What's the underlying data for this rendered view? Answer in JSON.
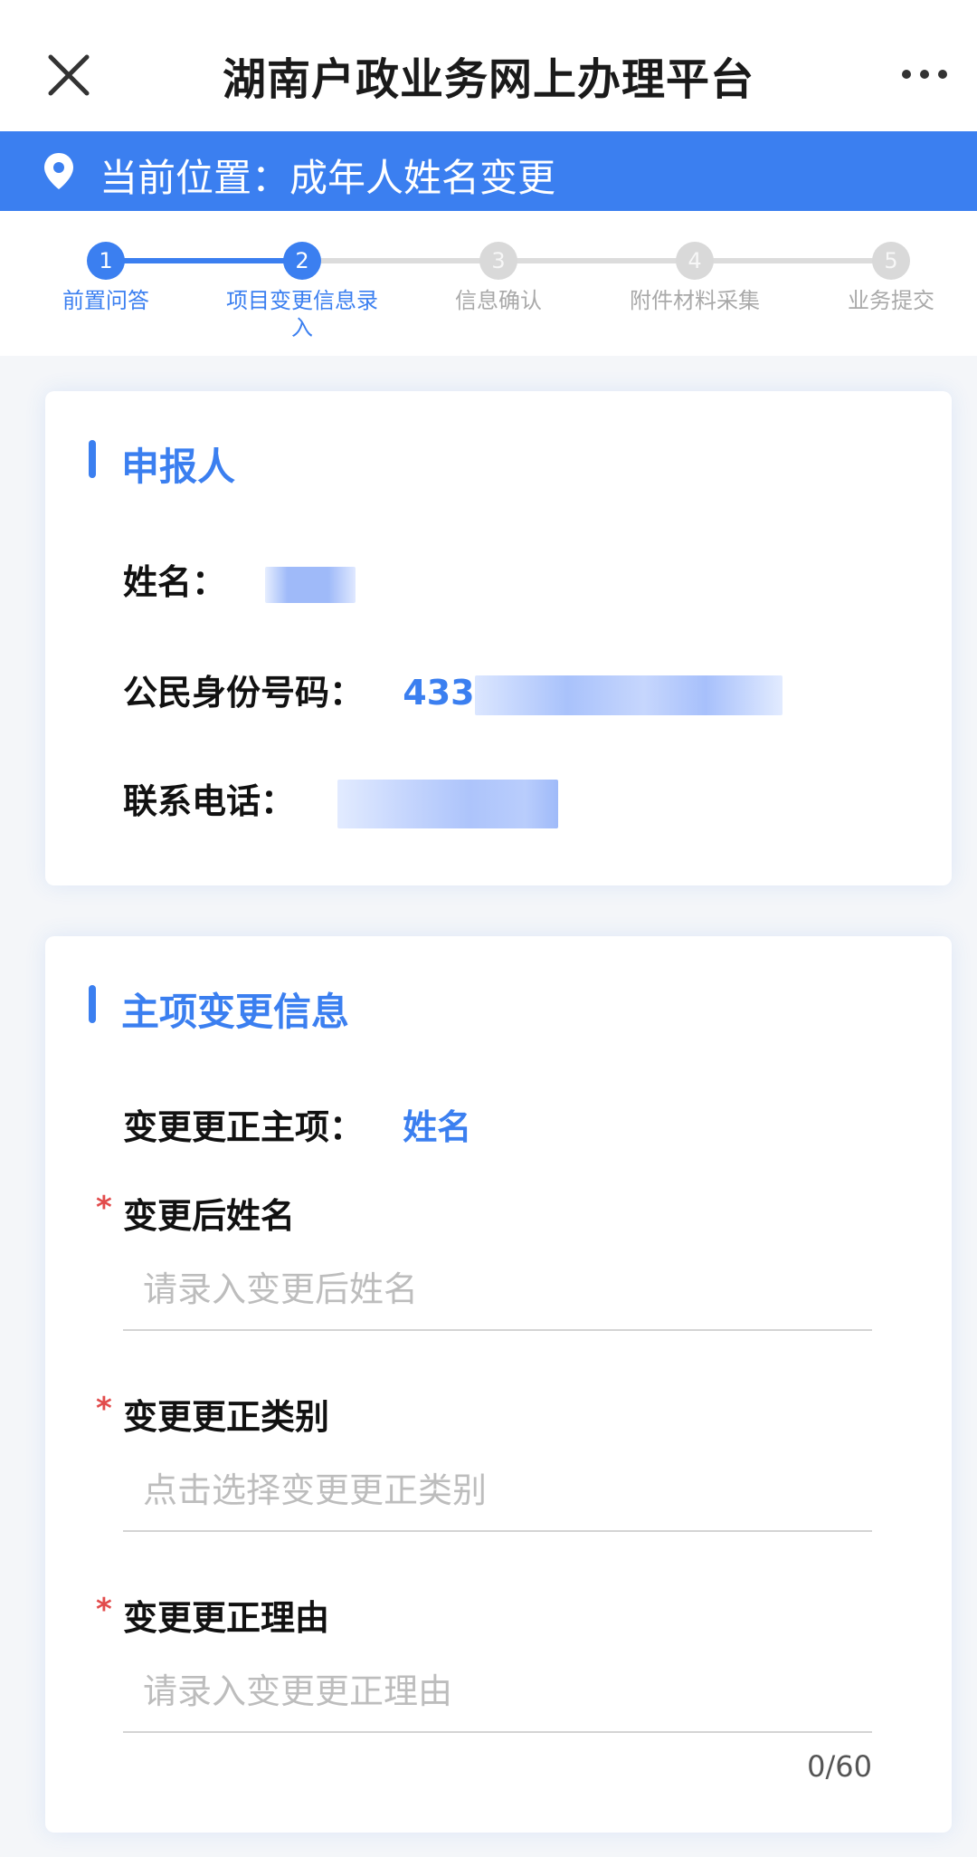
{
  "header": {
    "title": "湖南户政业务网上办理平台",
    "close_icon": "close-icon",
    "more_icon": "more-dots-icon"
  },
  "location": {
    "icon": "location-pin-icon",
    "label": "当前位置：成年人姓名变更"
  },
  "steps": [
    {
      "num": "1",
      "label": "前置问答",
      "state": "done"
    },
    {
      "num": "2",
      "label": "项目变更信息录入",
      "state": "current"
    },
    {
      "num": "3",
      "label": "信息确认",
      "state": "todo"
    },
    {
      "num": "4",
      "label": "附件材料采集",
      "state": "todo"
    },
    {
      "num": "5",
      "label": "业务提交",
      "state": "todo"
    }
  ],
  "applicant": {
    "section_title": "申报人",
    "name_label": "姓名：",
    "id_label": "公民身份号码：",
    "id_prefix": "433",
    "phone_label": "联系电话："
  },
  "change_info": {
    "section_title": "主项变更信息",
    "main_item_label": "变更更正主项：",
    "main_item_value": "姓名",
    "new_name": {
      "label": "变更后姓名",
      "placeholder": "请录入变更后姓名"
    },
    "category": {
      "label": "变更更正类别",
      "placeholder": "点击选择变更更正类别"
    },
    "reason": {
      "label": "变更更正理由",
      "placeholder": "请录入变更更正理由",
      "counter": "0/60"
    }
  },
  "colors": {
    "primary": "#3b7ff0",
    "required": "#e24b4b",
    "inactive": "#d9d9d9"
  }
}
